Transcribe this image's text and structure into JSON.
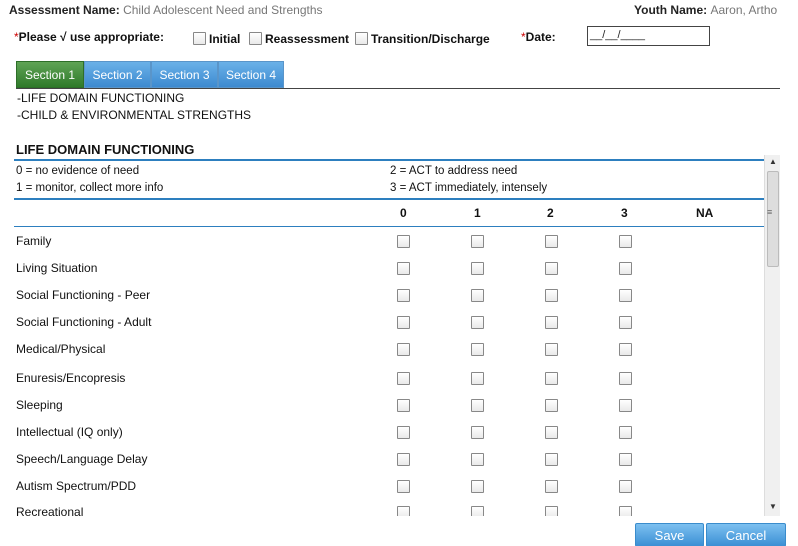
{
  "header": {
    "assessment_label": "Assessment Name:",
    "assessment_value": "Child Adolescent Need and Strengths",
    "youth_label": "Youth Name:",
    "youth_value": "Aaron, Artho"
  },
  "type_row": {
    "required_mark": "*",
    "prompt": "Please √ use appropriate:",
    "options": [
      "Initial",
      "Reassessment",
      "Transition/Discharge"
    ],
    "date_label": "Date:",
    "date_placeholder": "__/__/____"
  },
  "tabs": [
    "Section 1",
    "Section 2",
    "Section 3",
    "Section 4"
  ],
  "active_tab": "Section 1",
  "section_list": [
    "-LIFE DOMAIN FUNCTIONING",
    "-CHILD & ENVIRONMENTAL STRENGTHS"
  ],
  "section": {
    "title": "LIFE DOMAIN FUNCTIONING",
    "legend": [
      "0 = no evidence of need",
      "2 = ACT to address need",
      "1 = monitor, collect more info",
      "3 = ACT immediately, intensely"
    ],
    "columns": [
      "0",
      "1",
      "2",
      "3",
      "NA"
    ],
    "rows": [
      "Family",
      "Living Situation",
      "Social Functioning - Peer",
      "Social Functioning - Adult",
      "Medical/Physical",
      "Enuresis/Encopresis",
      "Sleeping",
      "Intellectual (IQ only)",
      "Speech/Language Delay",
      "Autism Spectrum/PDD",
      "Recreational"
    ]
  },
  "footer": {
    "save_label": "Save",
    "cancel_label": "Cancel"
  },
  "colors": {
    "active_tab": "#3b852f",
    "tab": "#4a9ad9",
    "rule": "#2d7fbf",
    "required": "#cc0000",
    "button": "#4d9ee0"
  }
}
